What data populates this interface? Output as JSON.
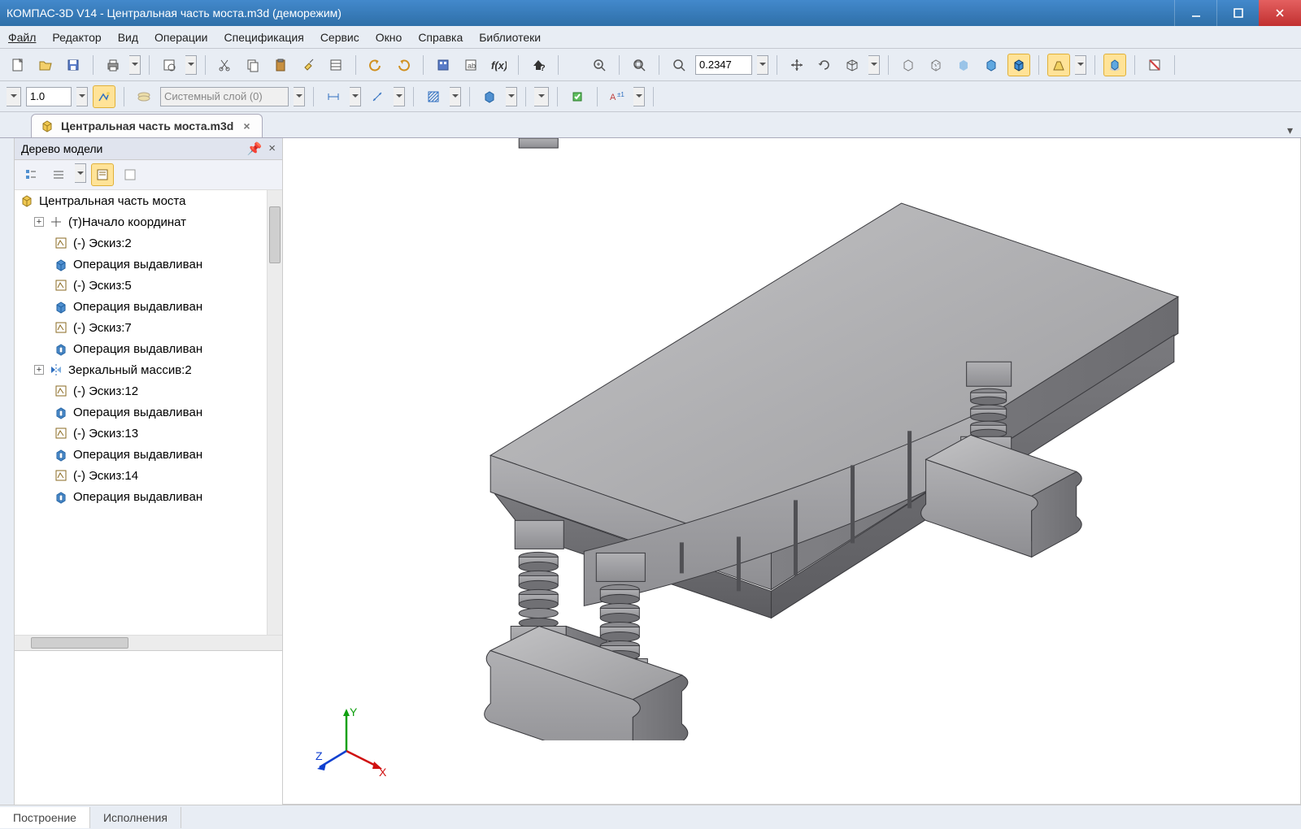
{
  "window": {
    "title": "КОМПАС-3D V14 - Центральная часть моста.m3d (деморежим)"
  },
  "menu": {
    "items": [
      "Файл",
      "Редактор",
      "Вид",
      "Операции",
      "Спецификация",
      "Сервис",
      "Окно",
      "Справка",
      "Библиотеки"
    ]
  },
  "toolbar1": {
    "zoom_value": "0.2347"
  },
  "toolbar2": {
    "lineweight": "1.0",
    "layer": "Системный слой (0)"
  },
  "doc_tab": {
    "label": "Центральная часть моста.m3d"
  },
  "model_tree": {
    "title": "Дерево модели",
    "root": "Центральная часть моста",
    "nodes": [
      {
        "expand": "+",
        "icon": "origin",
        "label": "(т)Начало координат"
      },
      {
        "icon": "sketch",
        "label": "(-) Эскиз:2"
      },
      {
        "icon": "extrude",
        "label": "Операция выдавливан"
      },
      {
        "icon": "sketch",
        "label": "(-) Эскиз:5"
      },
      {
        "icon": "extrude",
        "label": "Операция выдавливан"
      },
      {
        "icon": "sketch",
        "label": "(-) Эскиз:7"
      },
      {
        "icon": "extrude-cut",
        "label": "Операция выдавливан"
      },
      {
        "expand": "+",
        "icon": "mirror",
        "label": "Зеркальный массив:2"
      },
      {
        "icon": "sketch",
        "label": "(-) Эскиз:12"
      },
      {
        "icon": "extrude-cut",
        "label": "Операция выдавливан"
      },
      {
        "icon": "sketch",
        "label": "(-) Эскиз:13"
      },
      {
        "icon": "extrude-cut",
        "label": "Операция выдавливан"
      },
      {
        "icon": "sketch",
        "label": "(-) Эскиз:14"
      },
      {
        "icon": "extrude-cut",
        "label": "Операция выдавливан"
      }
    ]
  },
  "bottom_tabs": {
    "tab1": "Построение",
    "tab2": "Исполнения"
  },
  "axis": {
    "x": "X",
    "y": "Y",
    "z": "Z"
  }
}
